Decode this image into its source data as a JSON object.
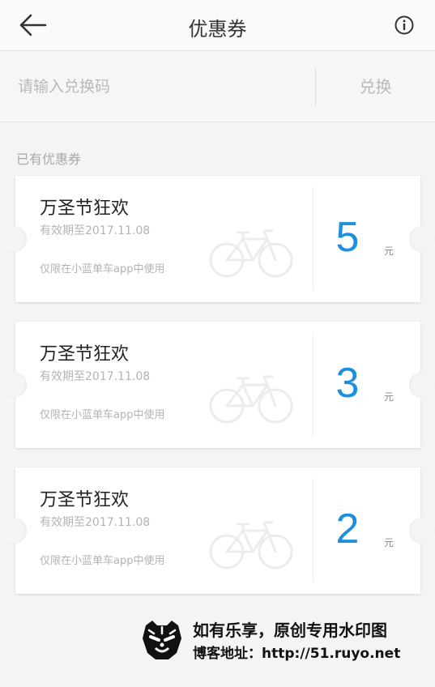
{
  "header": {
    "title": "优惠券",
    "back_icon": "arrow-left-icon",
    "info_icon": "info-circle-icon"
  },
  "redeem": {
    "placeholder": "请输入兑换码",
    "value": "",
    "button_label": "兑换"
  },
  "section_label": "已有优惠券",
  "coupons": [
    {
      "title": "万圣节狂欢",
      "expiry": "有效期至2017.11.08",
      "restriction": "仅限在小蓝单车app中使用",
      "amount": "5",
      "unit": "元",
      "icon": "bicycle-icon"
    },
    {
      "title": "万圣节狂欢",
      "expiry": "有效期至2017.11.08",
      "restriction": "仅限在小蓝单车app中使用",
      "amount": "3",
      "unit": "元",
      "icon": "bicycle-icon"
    },
    {
      "title": "万圣节狂欢",
      "expiry": "有效期至2017.11.08",
      "restriction": "仅限在小蓝单车app中使用",
      "amount": "2",
      "unit": "元",
      "icon": "bicycle-icon"
    }
  ],
  "watermark": {
    "line1": "如有乐享，原创专用水印图",
    "line2": "博客地址：http://51.ruyo.net",
    "logo_icon": "tiger-logo-icon"
  },
  "colors": {
    "accent": "#1e8fdd",
    "background": "#f4f4f4",
    "muted_text": "#b3b3b3"
  }
}
